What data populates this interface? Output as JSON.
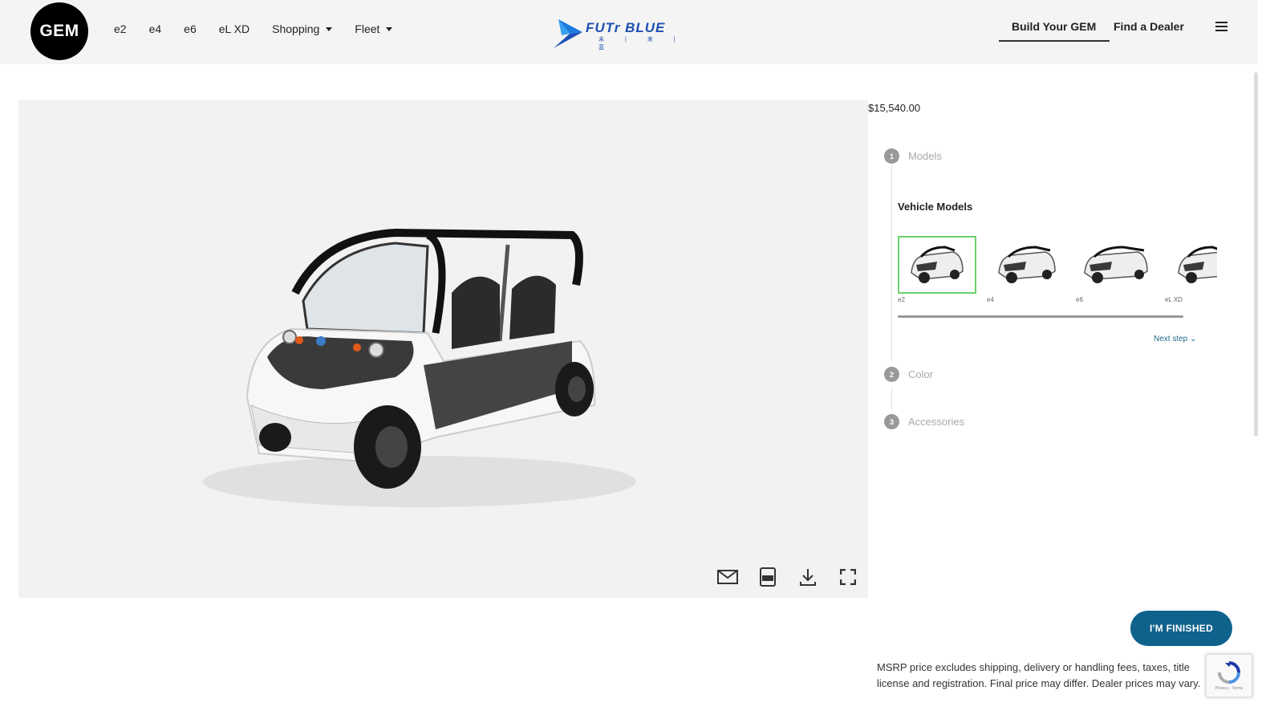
{
  "header": {
    "logo_text": "GEM",
    "nav": [
      "e2",
      "e4",
      "e6",
      "eL XD"
    ],
    "shopping_label": "Shopping",
    "fleet_label": "Fleet",
    "brand_name": "FUTr BLUE",
    "brand_sub": "未 | 来 | 蓝",
    "build_label": "Build Your GEM",
    "dealer_label": "Find a Dealer"
  },
  "config": {
    "price": "$15,540.00",
    "steps": [
      {
        "num": "1",
        "label": "Models"
      },
      {
        "num": "2",
        "label": "Color"
      },
      {
        "num": "3",
        "label": "Accessories"
      }
    ],
    "models_title": "Vehicle Models",
    "models": [
      {
        "label": "e2",
        "selected": true
      },
      {
        "label": "e4",
        "selected": false
      },
      {
        "label": "e6",
        "selected": false
      },
      {
        "label": "eL XD",
        "selected": false
      }
    ],
    "next_step": "Next step ⌄",
    "finish_label": "I'M FINISHED",
    "disclaimer": "MSRP price excludes shipping, delivery or handling fees, taxes, title license and registration. Final price may differ. Dealer prices may vary.",
    "selected_border_color": "#6bd16b",
    "accent_color": "#0e628c"
  },
  "recaptcha": {
    "footer": "Privacy - Terms"
  }
}
